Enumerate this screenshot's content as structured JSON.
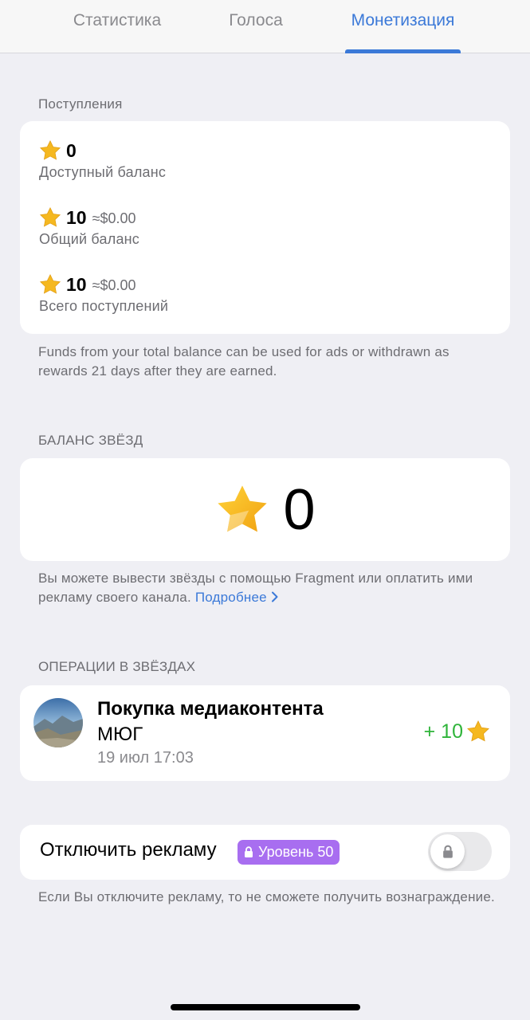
{
  "tabs": [
    {
      "label": "Статистика"
    },
    {
      "label": "Голоса"
    },
    {
      "label": "Монетизация"
    }
  ],
  "income": {
    "header": "Поступления",
    "available": {
      "value": "0",
      "label": "Доступный баланс"
    },
    "total_balance": {
      "value": "10",
      "usd": "≈$0.00",
      "label": "Общий баланс"
    },
    "total_income": {
      "value": "10",
      "usd": "≈$0.00",
      "label": "Всего поступлений"
    },
    "note": "Funds from your total balance can be used for ads or withdrawn as rewards 21 days after they are earned."
  },
  "stars_balance": {
    "header": "БАЛАНС ЗВЁЗД",
    "value": "0",
    "note": "Вы можете вывести звёзды с помощью Fragment или оплатить ими рекламу своего канала.",
    "link": "Подробнее"
  },
  "operations": {
    "header": "ОПЕРАЦИИ В ЗВЁЗДАХ",
    "items": [
      {
        "title": "Покупка медиаконтента",
        "subtitle": "МЮГ",
        "date": "19 июл 17:03",
        "amount": "+ 10"
      }
    ]
  },
  "ads": {
    "label": "Отключить рекламу",
    "badge": "Уровень 50",
    "note": "Если Вы отключите рекламу, то не сможете получить вознаграждение."
  },
  "colors": {
    "accent": "#3b79d8",
    "positive": "#2fb43a",
    "badge": "#a86ef0",
    "star": "#f5b820"
  },
  "icons": {
    "star": "star-icon",
    "lock": "lock-icon",
    "chevron": "chevron-right-icon"
  }
}
